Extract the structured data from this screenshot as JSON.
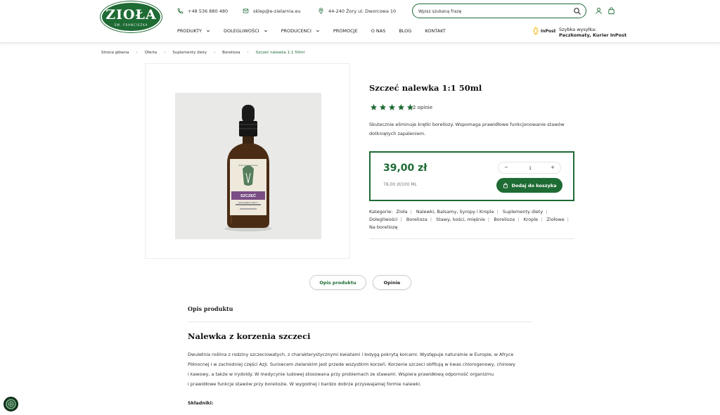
{
  "brand": {
    "logo_text": "ZIOŁA",
    "logo_sub": "ŚW. FRANCISZKA",
    "green": "#1e6b34"
  },
  "header": {
    "phone": "+48 536 880 480",
    "email": "sklep@e-zielarnia.eu",
    "address": "44-240 Żory ul. Dworcowa 10",
    "search_placeholder": "Wpisz szukaną frazę",
    "icons": [
      "phone-icon",
      "mail-icon",
      "location-pin-icon",
      "search-icon",
      "user-icon",
      "cart-bag-icon"
    ]
  },
  "nav": {
    "items": [
      {
        "label": "PRODUKTY",
        "dropdown": true
      },
      {
        "label": "DOLEGLIWOŚCI",
        "dropdown": true
      },
      {
        "label": "PRODUCENCI",
        "dropdown": true
      },
      {
        "label": "PROMOCJE",
        "dropdown": false
      },
      {
        "label": "O NAS",
        "dropdown": false
      },
      {
        "label": "BLOG",
        "dropdown": false
      },
      {
        "label": "KONTAKT",
        "dropdown": false
      }
    ]
  },
  "shipping": {
    "inpost": "InPost",
    "line1": "Szybka wysyłka:",
    "line2": "Paczkomaty, Kurier InPost"
  },
  "breadcrumb": [
    "Strona główna",
    "Oferta",
    "Suplementy diety",
    "Borelioza",
    "Szczeć nalewka 1:1 50ml"
  ],
  "product": {
    "title": "Szczeć nalewka 1:1 50ml",
    "rating": 5,
    "reviews": "2 opinie",
    "description_lines": [
      "Skutecznie eliminuje krętki boreliozy. Wspomaga prawidłowe funkcjonowanie stawów",
      "dotkniętych zapaleniem."
    ],
    "price": "39,00 zł",
    "unit_price": "78,00 zł/100 ML",
    "qty_minus": "−",
    "qty_value": "1",
    "qty_plus": "+",
    "add_to_cart": "Dodaj do koszyka",
    "categories_label": "Kategorie:",
    "categories": [
      "Zioła",
      "Nalewki, Balsamy, Syropy i Krople",
      "Suplementy diety",
      "Dolegliwości",
      "Borelioza",
      "Stawy, kości, mięśnie",
      "Borelioza",
      "Krople",
      "Ziołowe",
      "Na boreliozę"
    ],
    "bottle_label": {
      "brand": "Zioła św. Franciszka",
      "name": "SZCZEĆ",
      "sub": "SUPLEMENT DIETY"
    }
  },
  "tabs": [
    "Opis produktu",
    "Opinie"
  ],
  "description": {
    "section_title": "Opis produktu",
    "heading": "Nalewka z korzenia szczeci",
    "lines": [
      "Dwuletnia roślina z rodziny szczeciowatych, z charakterystycznymi kwiatami i łodygą pokrytą kolcami. Występuje naturalnie w Europie, w Afryce",
      "Północnej i w zachodniej części Azji. Surowcem zielarskim jest przede wszystkim korzeń. Korzenie szczeci obfitują w kwas chlorogenowy, chinowy",
      "i kawowy, a także w irydoidy. W medycynie ludowej stosowana przy problemach ze stawami. Wspiera prawidłową odporność organizmu",
      "i prawidłowe funkcje stawów przy boreliozie. W wygodnej i bardzo dobrze przyswajalnej formie nalewki."
    ],
    "ingredients_label": "Składniki:"
  }
}
